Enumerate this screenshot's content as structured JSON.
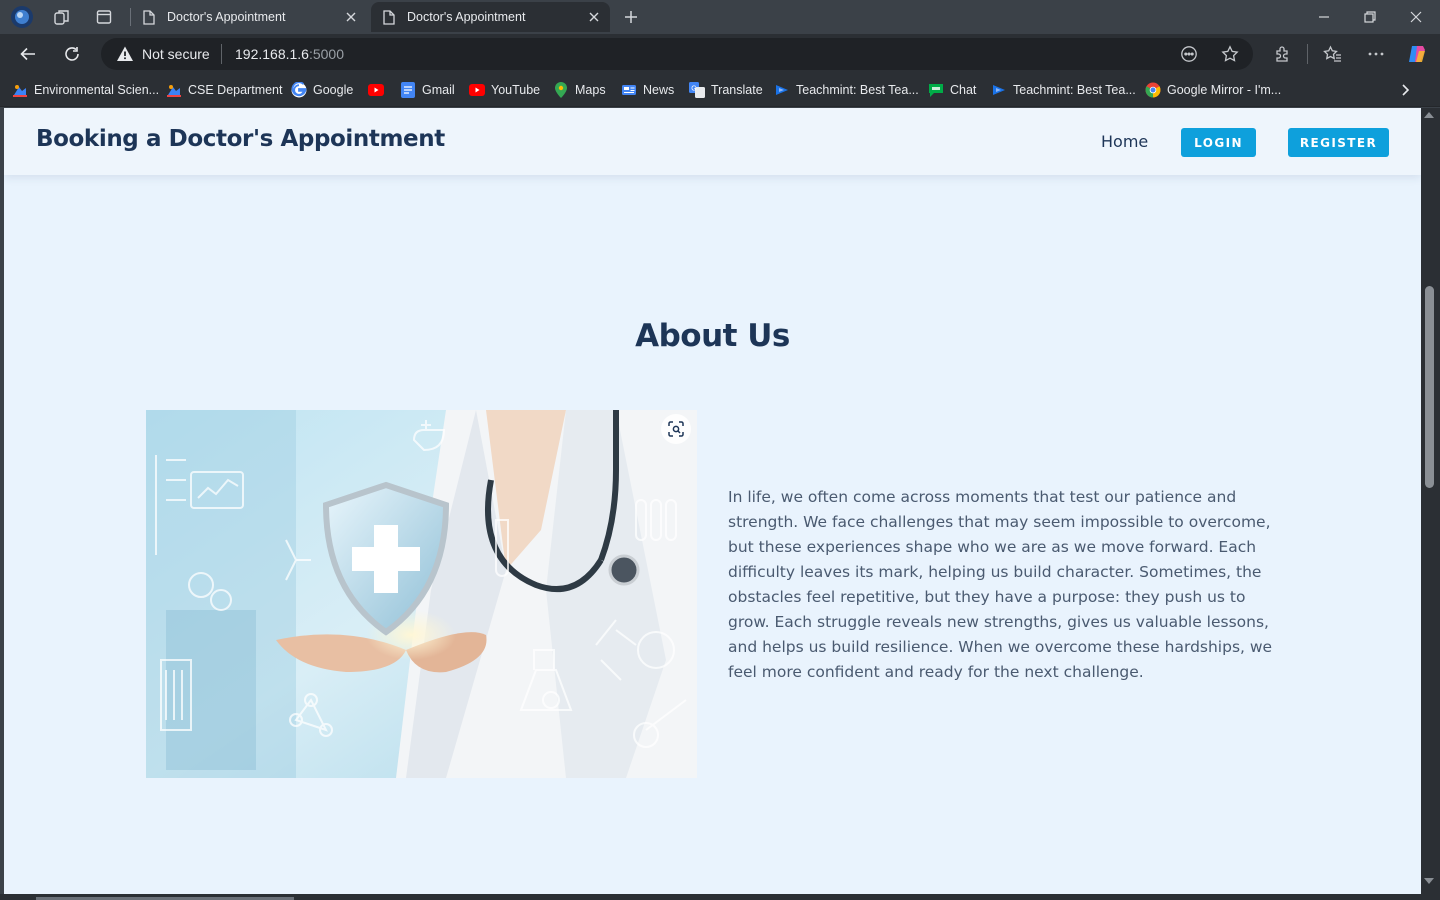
{
  "browser": {
    "tabs": [
      {
        "title": "Doctor's Appointment",
        "active": false
      },
      {
        "title": "Doctor's Appointment",
        "active": true
      }
    ],
    "address": {
      "security_label": "Not secure",
      "host": "192.168.1.6",
      "port": ":5000"
    },
    "bookmarks": [
      {
        "label": "Environmental Scien...",
        "icon": "app-icon"
      },
      {
        "label": "CSE Department",
        "icon": "app-icon"
      },
      {
        "label": "Google",
        "icon": "google-icon"
      },
      {
        "label": "",
        "icon": "youtube-icon"
      },
      {
        "label": "Gmail",
        "icon": "docs-icon"
      },
      {
        "label": "YouTube",
        "icon": "youtube-icon"
      },
      {
        "label": "Maps",
        "icon": "maps-icon"
      },
      {
        "label": "News",
        "icon": "news-icon"
      },
      {
        "label": "Translate",
        "icon": "translate-icon"
      },
      {
        "label": "Teachmint: Best Tea...",
        "icon": "teachmint-icon"
      },
      {
        "label": "Chat",
        "icon": "chat-icon"
      },
      {
        "label": "Teachmint: Best Tea...",
        "icon": "teachmint-icon"
      },
      {
        "label": "Google Mirror - I'm...",
        "icon": "chrome-icon"
      }
    ]
  },
  "site": {
    "brand": "Booking a Doctor's Appointment",
    "nav": {
      "home": "Home",
      "login": "LOGIN",
      "register": "REGISTER"
    }
  },
  "about": {
    "title": "About Us",
    "image_alt": "Doctor holding a glowing medical shield icon",
    "body": "In life, we often come across moments that test our patience and strength. We face challenges that may seem impossible to overcome, but these experiences shape who we are as we move forward. Each difficulty leaves its mark, helping us build character. Sometimes, the obstacles feel repetitive, but they have a purpose: they push us to grow. Each struggle reveals new strengths, gives us valuable lessons, and helps us build resilience. When we overcome these hardships, we feel more confident and ready for the next challenge."
  },
  "colors": {
    "page_background": "#e9f3fd",
    "heading": "#1d3557",
    "accent_button": "#0ea0dc",
    "body_text": "#4a5a70"
  }
}
